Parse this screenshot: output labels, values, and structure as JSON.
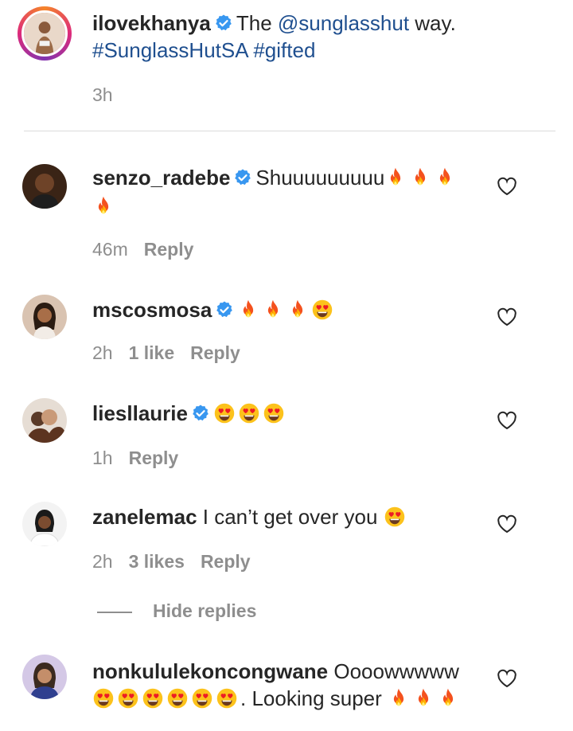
{
  "caption": {
    "username": "ilovekhanya",
    "text_pre": "The ",
    "mention": "@sunglasshut",
    "text_post": " way.",
    "hashtags": "#SunglassHutSA #gifted",
    "time": "3h"
  },
  "comments": [
    {
      "username": "senzo_radebe",
      "text": "Shuuuuuuuuu",
      "time": "46m",
      "likes": "",
      "reply": "Reply"
    },
    {
      "username": "mscosmosa",
      "text": "",
      "time": "2h",
      "likes": "1 like",
      "reply": "Reply"
    },
    {
      "username": "liesllaurie",
      "text": "",
      "time": "1h",
      "likes": "",
      "reply": "Reply"
    },
    {
      "username": "zanelemac",
      "text": "I can’t get over you",
      "time": "2h",
      "likes": "3 likes",
      "reply": "Reply"
    },
    {
      "username": "nonkululekoncongwane",
      "text": "Oooowwwww",
      "text2": ". Looking super",
      "time": "",
      "likes": "",
      "reply": ""
    }
  ],
  "hide_replies": "Hide replies",
  "icons": {
    "verified": "verified-badge-icon",
    "heart": "heart-outline-icon",
    "fire": "fire-emoji",
    "heart_eyes": "heart-eyes-emoji"
  },
  "colors": {
    "verified_blue": "#3897f0",
    "link": "#1f4f8f",
    "meta_gray": "#8e8e8e"
  }
}
